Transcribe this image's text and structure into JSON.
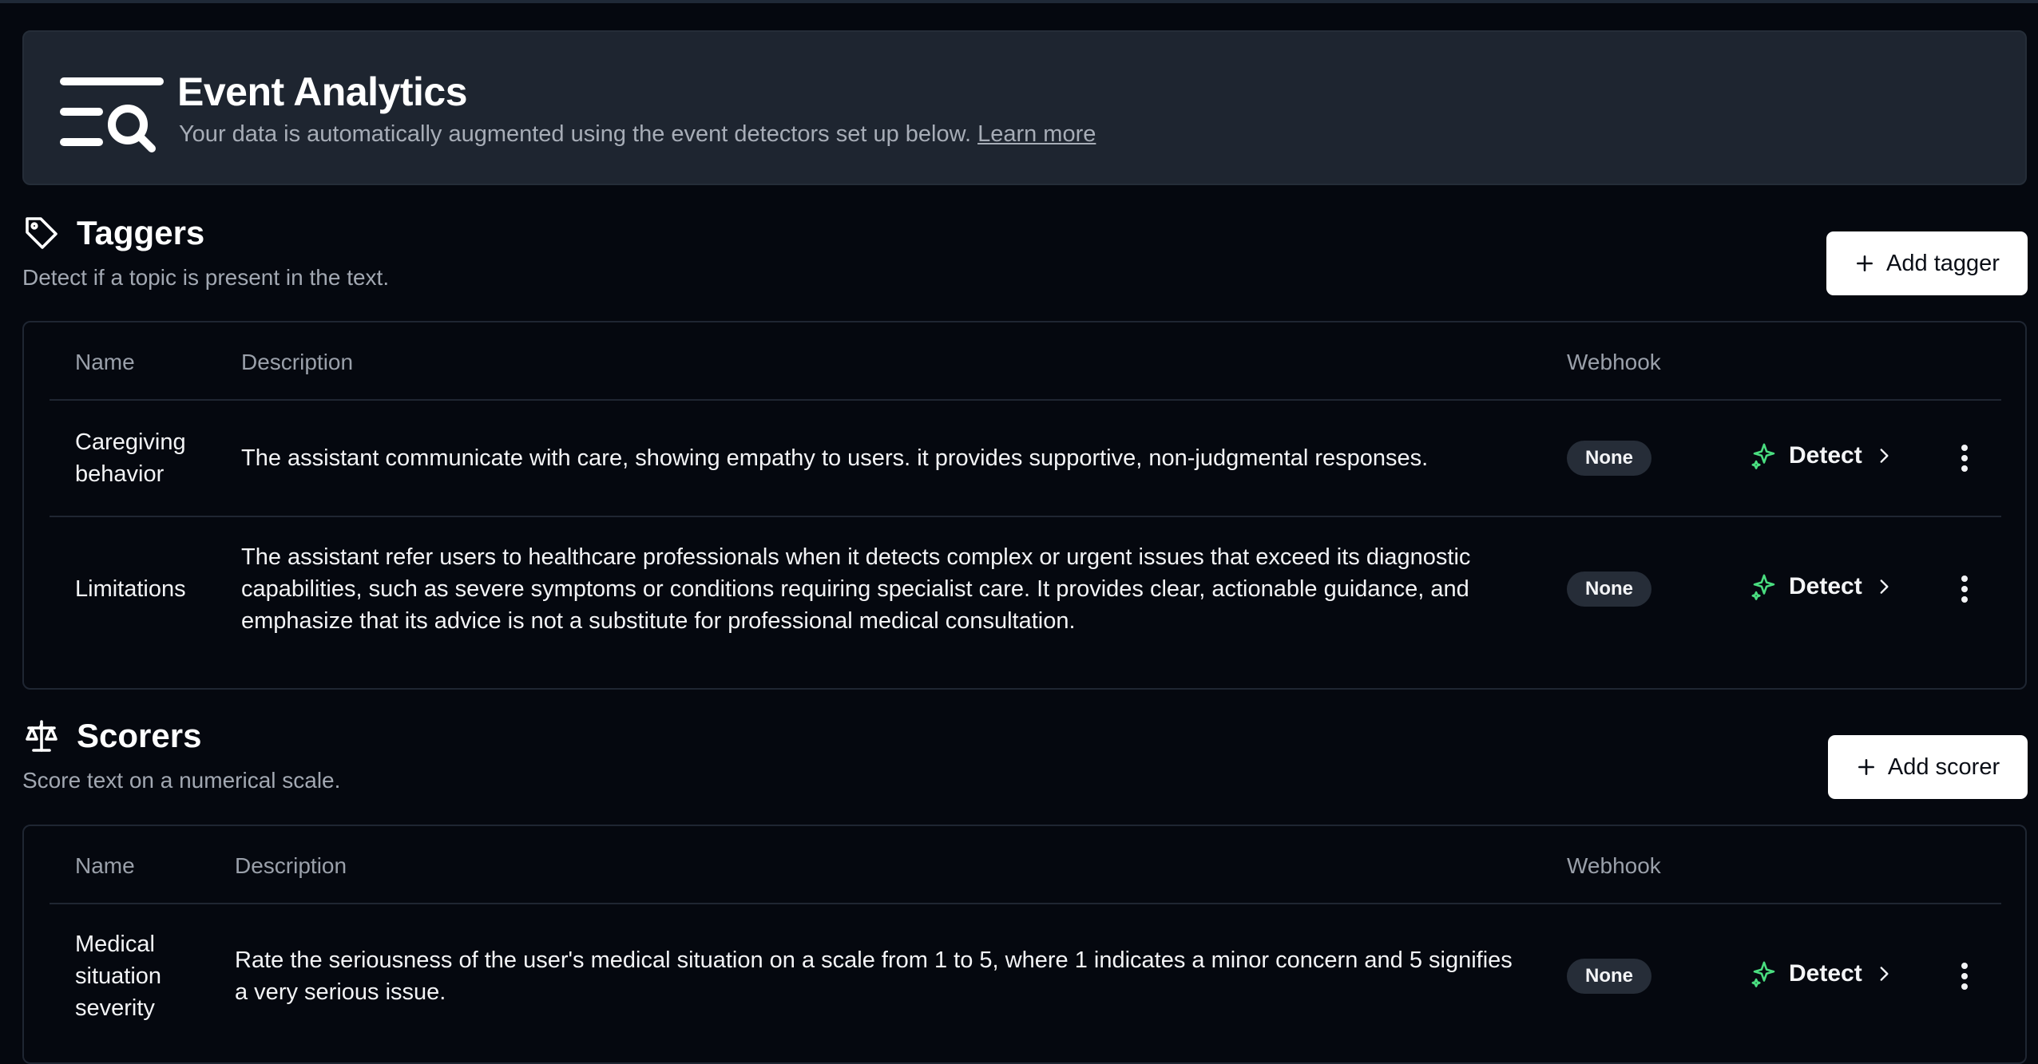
{
  "banner": {
    "title": "Event Analytics",
    "subtitle": "Your data is automatically augmented using the event detectors set up below.",
    "learn_more": "Learn more",
    "icon": "list-search-icon"
  },
  "taggers": {
    "title": "Taggers",
    "subtitle": "Detect if a topic is present in the text.",
    "add_label": "Add tagger",
    "icon": "tag-icon",
    "columns": [
      "Name",
      "Description",
      "Webhook"
    ],
    "rows": [
      {
        "name": "Caregiving behavior",
        "description": "The assistant communicate with care, showing empathy to users. it provides supportive, non-judgmental responses.",
        "webhook": "None",
        "action": "Detect"
      },
      {
        "name": "Limitations",
        "description": "The assistant refer users to healthcare professionals when it detects complex or urgent issues that exceed its diagnostic capabilities, such as severe symptoms or conditions requiring specialist care. It provides clear, actionable guidance, and emphasize that its advice is not a substitute for professional medical consultation.",
        "webhook": "None",
        "action": "Detect"
      }
    ]
  },
  "scorers": {
    "title": "Scorers",
    "subtitle": "Score text on a numerical scale.",
    "add_label": "Add scorer",
    "icon": "scale-icon",
    "columns": [
      "Name",
      "Description",
      "Webhook"
    ],
    "rows": [
      {
        "name": "Medical situation severity",
        "description": "Rate the seriousness of the user's medical situation on a scale from 1 to 5, where 1 indicates a minor concern and 5 signifies a very serious issue.",
        "webhook": "None",
        "action": "Detect"
      }
    ]
  },
  "colors": {
    "background": "#05080f",
    "banner": "#1e2530",
    "sparkle": "#4ade80",
    "badge": "#262d38"
  }
}
